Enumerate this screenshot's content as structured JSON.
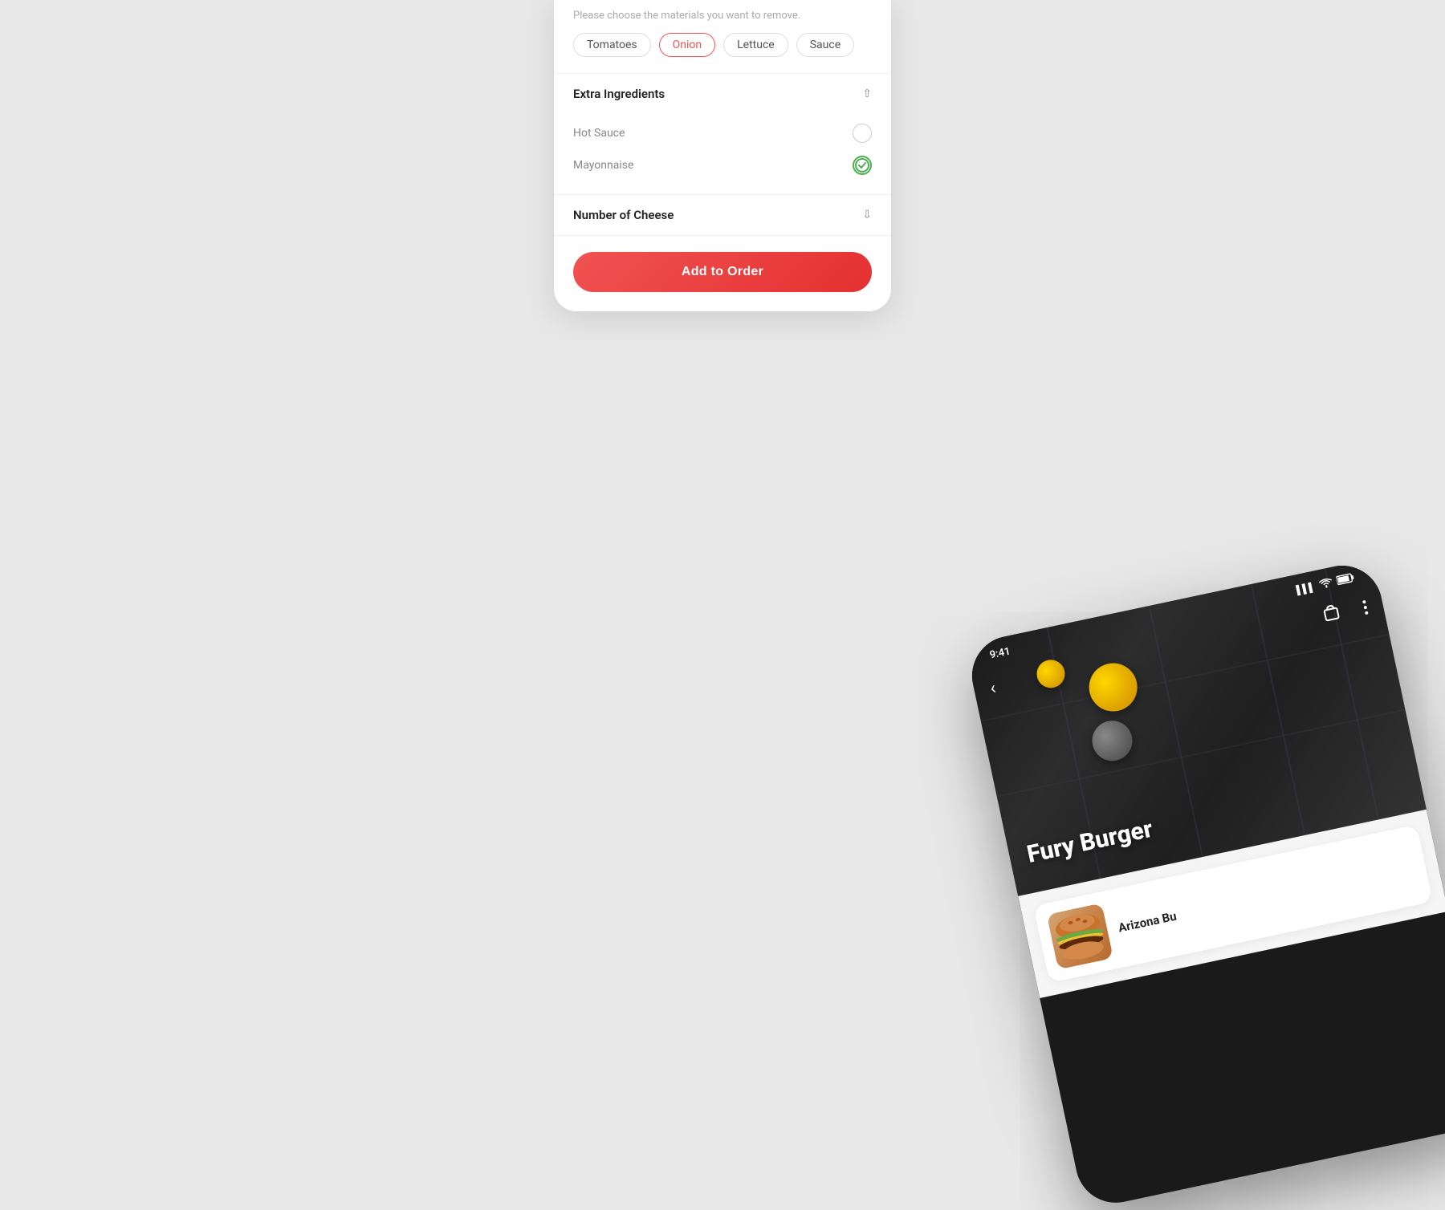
{
  "background": {
    "color": "#e8e8e8"
  },
  "top_card": {
    "remove_hint": "Please choose the materials you want to remove.",
    "tags": [
      {
        "label": "Tomatoes",
        "selected": false
      },
      {
        "label": "Onion",
        "selected": true
      },
      {
        "label": "Lettuce",
        "selected": false
      },
      {
        "label": "Sauce",
        "selected": false
      }
    ],
    "extra_ingredients": {
      "title": "Extra Ingredients",
      "expanded": true,
      "items": [
        {
          "name": "Hot Sauce",
          "checked": false
        },
        {
          "name": "Mayonnaise",
          "checked": true
        }
      ]
    },
    "number_of_cheese": {
      "title": "Number of Cheese",
      "expanded": false
    },
    "add_to_order_label": "Add to Order"
  },
  "phone": {
    "time": "9:41",
    "restaurant_name": "Fury Burger",
    "back_icon": "‹",
    "more_icon": "⋮",
    "bag_icon": "🛍",
    "product_name": "Arizona Bu",
    "status_icons": {
      "signal": "▌▌▌",
      "wifi": "wifi",
      "battery": "battery"
    }
  }
}
